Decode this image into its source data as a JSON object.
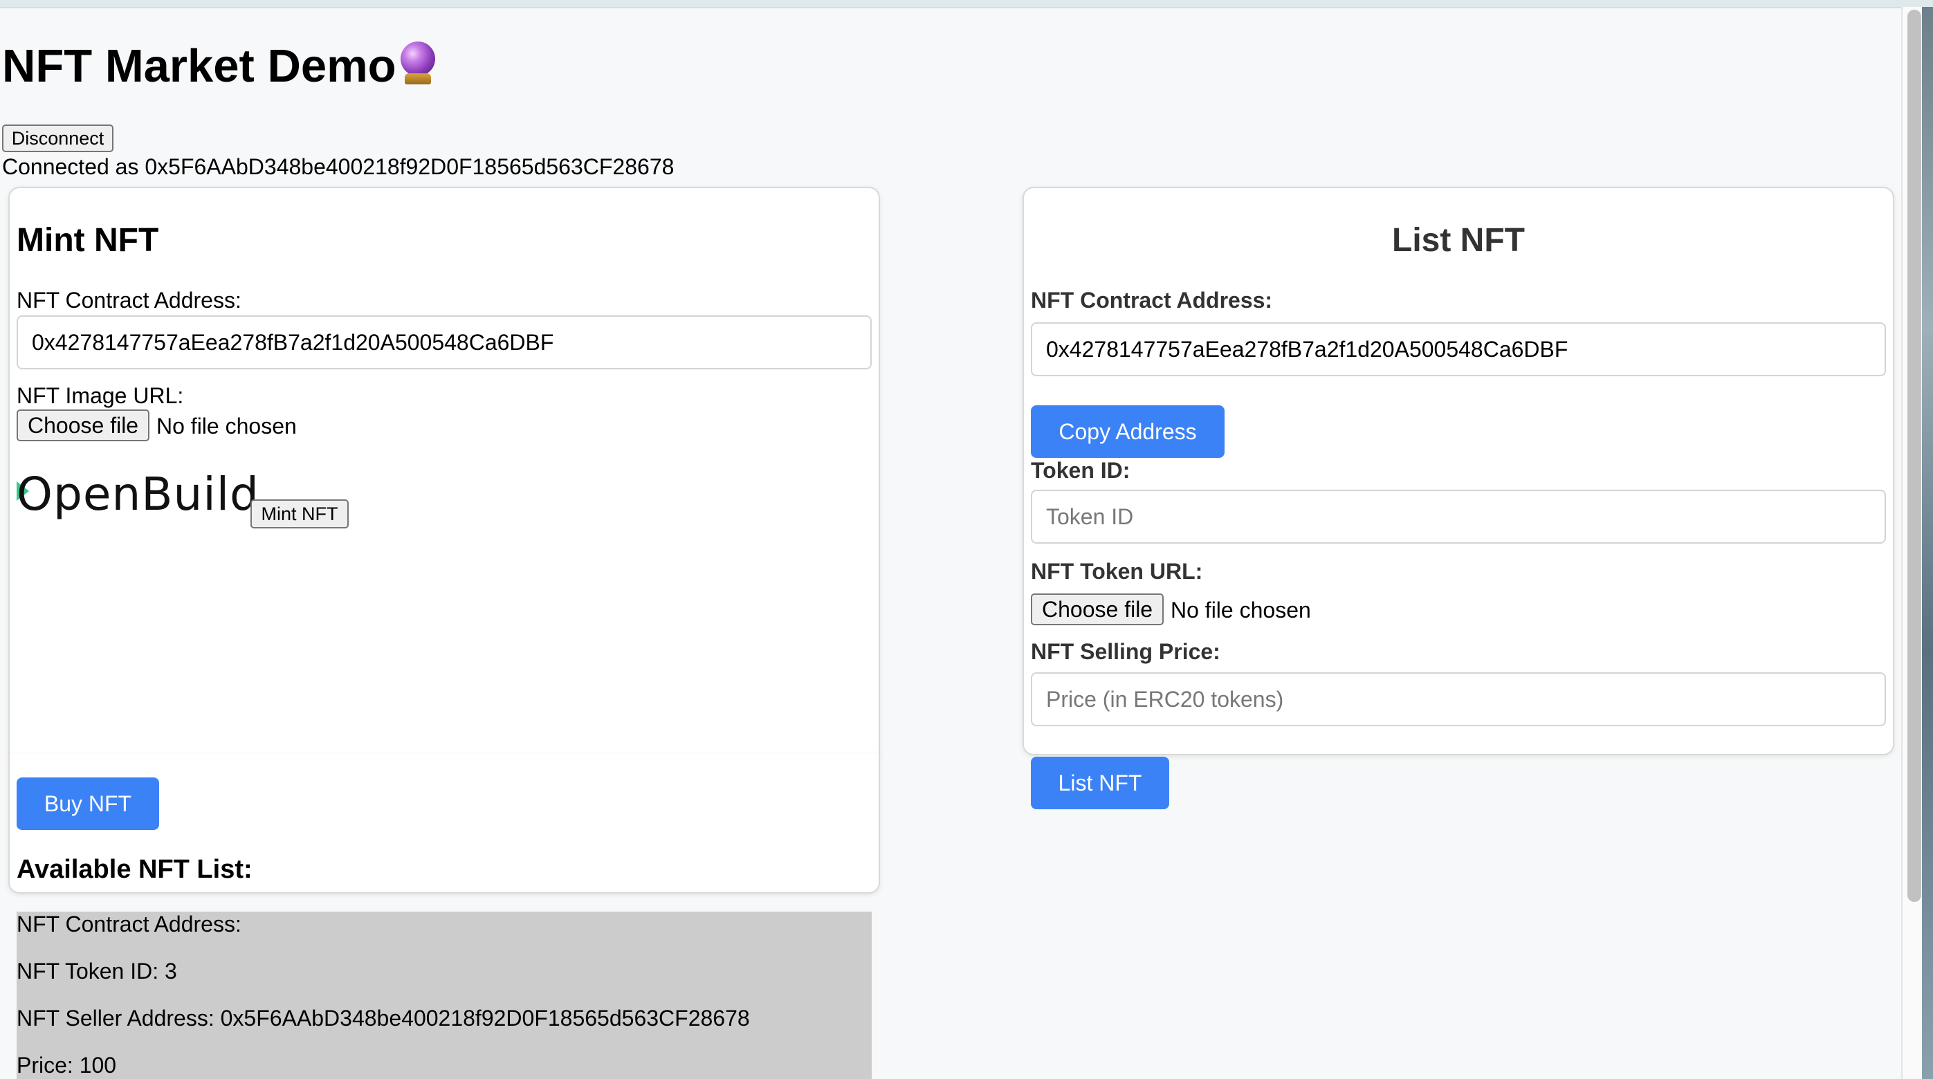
{
  "header": {
    "title": "NFT Market Demo",
    "disconnect_label": "Disconnect",
    "connected_text": "Connected as 0x5F6AAbD348be400218f92D0F18565d563CF28678"
  },
  "mint": {
    "heading": "Mint NFT",
    "contract_label": "NFT Contract Address:",
    "contract_value": "0x4278147757aEea278fB7a2f1d20A500548Ca6DBF",
    "image_url_label": "NFT Image URL:",
    "choose_file_label": "Choose file",
    "file_status": "No file chosen",
    "preview_logo_text": "OpenBuild",
    "mint_button_label": "Mint NFT",
    "buy_button_label": "Buy NFT",
    "available_heading": "Available NFT List:"
  },
  "list": {
    "heading": "List NFT",
    "contract_label": "NFT Contract Address:",
    "contract_value": "0x4278147757aEea278fB7a2f1d20A500548Ca6DBF",
    "copy_button_label": "Copy Address",
    "token_id_label": "Token ID:",
    "token_id_placeholder": "Token ID",
    "token_url_label": "NFT Token URL:",
    "choose_file_label": "Choose file",
    "file_status": "No file chosen",
    "price_label": "NFT Selling Price:",
    "price_placeholder": "Price (in ERC20 tokens)",
    "list_button_label": "List NFT"
  },
  "nft_items": [
    {
      "contract_line": "NFT Contract Address:",
      "token_line": "NFT Token ID: 3",
      "seller_line": "NFT Seller Address: 0x5F6AAbD348be400218f92D0F18565d563CF28678",
      "price_line": "Price: 100"
    }
  ],
  "colors": {
    "accent": "#3b82f6",
    "listing_background": "#cccccc",
    "logo_mark": "#38c98a"
  },
  "icons": {
    "title_emoji": "crystal-ball-icon"
  }
}
